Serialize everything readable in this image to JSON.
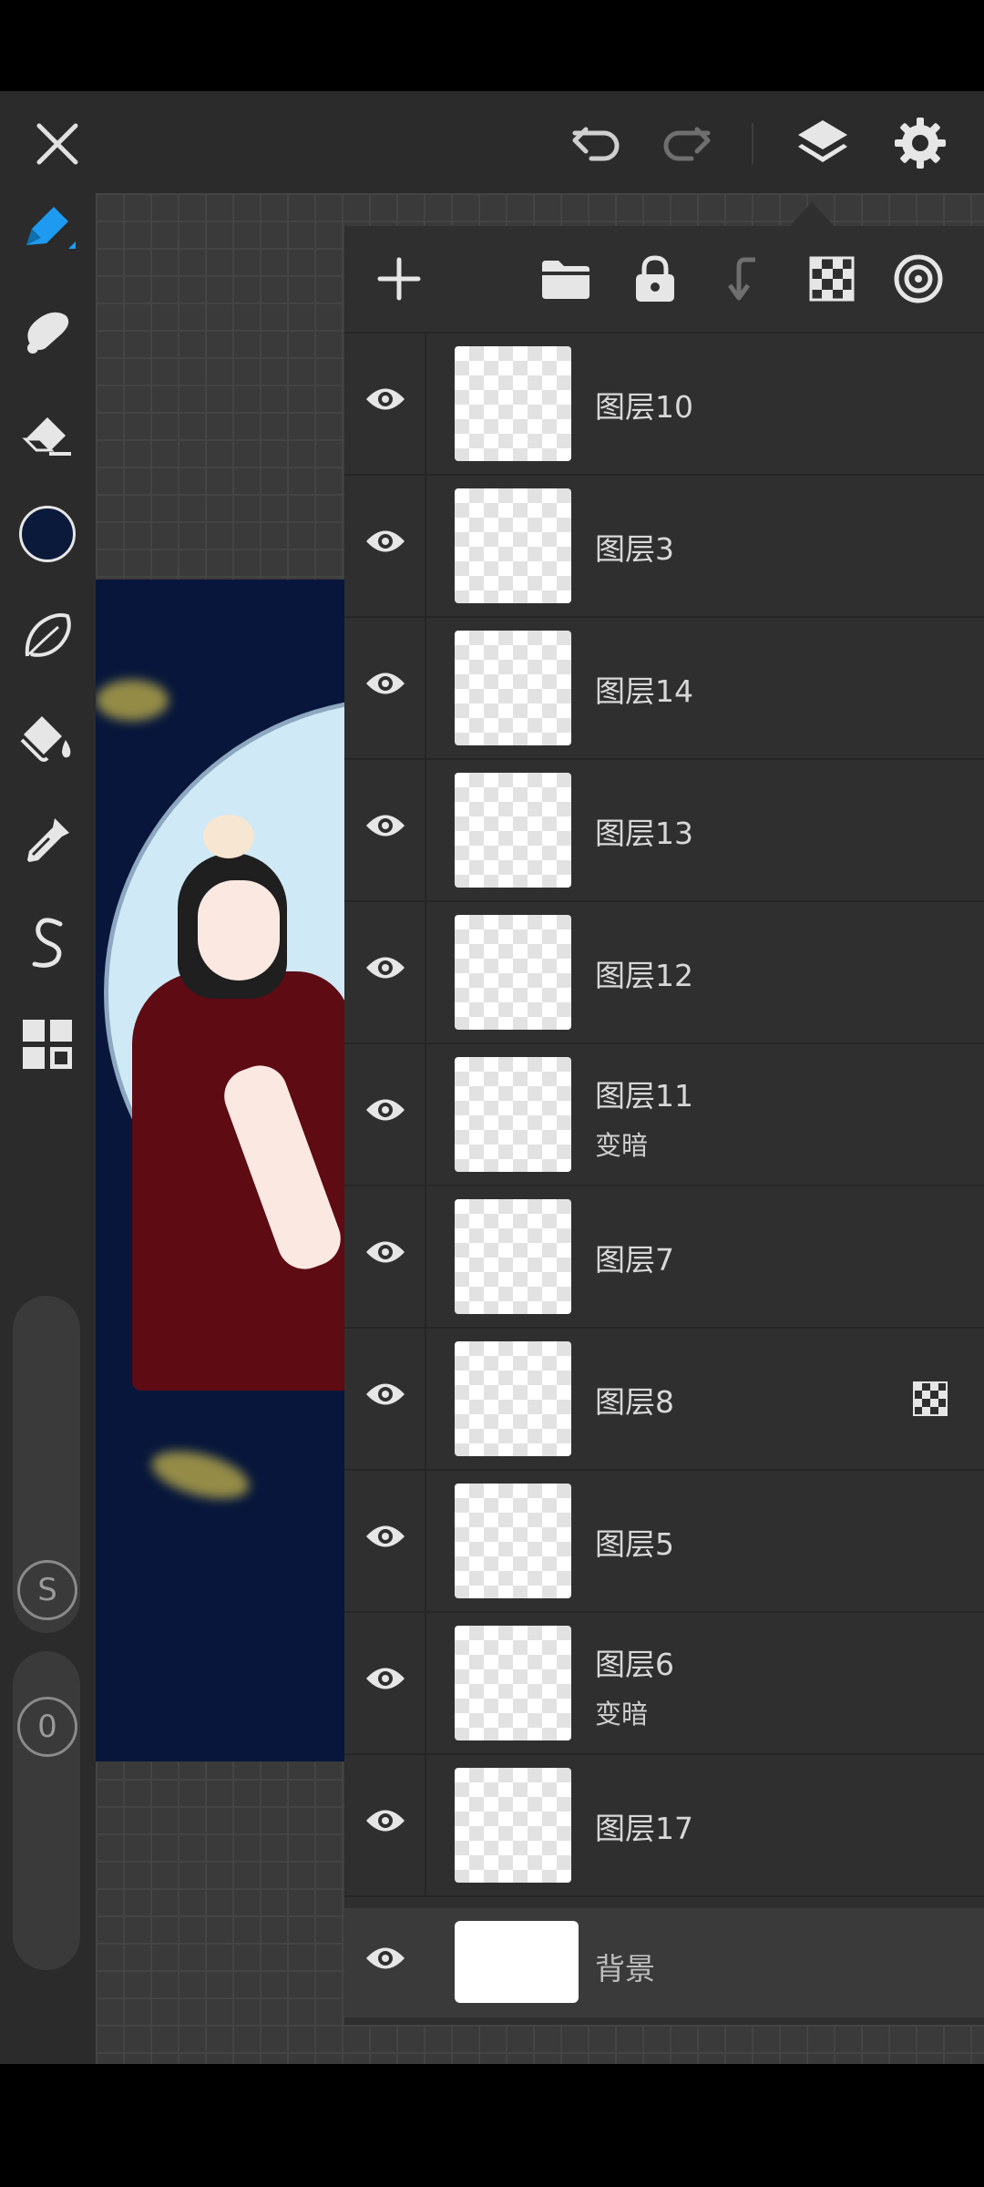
{
  "top_bar": {
    "close_icon": "close-icon",
    "undo_icon": "undo-icon",
    "redo_icon": "redo-icon",
    "layers_icon": "layers-icon",
    "settings_icon": "gear-icon"
  },
  "tools": [
    {
      "name": "pen-tool",
      "icon": "pen-icon",
      "active": true
    },
    {
      "name": "smudge-tool",
      "icon": "smudge-icon"
    },
    {
      "name": "eraser-tool",
      "icon": "eraser-icon"
    },
    {
      "name": "color-picker",
      "icon": "color-swatch",
      "color": "#0b1a3a"
    },
    {
      "name": "lasso-tool",
      "icon": "lasso-icon"
    },
    {
      "name": "fill-tool",
      "icon": "bucket-icon"
    },
    {
      "name": "eyedropper-tool",
      "icon": "eyedropper-icon"
    },
    {
      "name": "curve-tool",
      "icon": "curve-icon"
    },
    {
      "name": "more-tools",
      "icon": "grid-icon"
    }
  ],
  "size_slider_label": "S",
  "opacity_slider_label": "0",
  "layers_toolbar": {
    "add_icon": "plus-icon",
    "folder_icon": "folder-icon",
    "lock_icon": "lock-icon",
    "merge_down_icon": "merge-down-icon",
    "transparency_icon": "checker-icon",
    "blend_icon": "blend-icon"
  },
  "layers": [
    {
      "name": "图层10",
      "mode": "",
      "clip": false
    },
    {
      "name": "图层3",
      "mode": "",
      "clip": false
    },
    {
      "name": "图层14",
      "mode": "",
      "clip": false
    },
    {
      "name": "图层13",
      "mode": "",
      "clip": false
    },
    {
      "name": "图层12",
      "mode": "",
      "clip": false
    },
    {
      "name": "图层11",
      "mode": "变暗",
      "clip": false
    },
    {
      "name": "图层7",
      "mode": "",
      "clip": false
    },
    {
      "name": "图层8",
      "mode": "",
      "clip": true
    },
    {
      "name": "图层5",
      "mode": "",
      "clip": false
    },
    {
      "name": "图层6",
      "mode": "变暗",
      "clip": false
    },
    {
      "name": "图层17",
      "mode": "",
      "clip": false
    }
  ],
  "background_layer": {
    "name": "背景"
  },
  "colors": {
    "accent": "#1e9bf0",
    "panel": "#2f2f2f",
    "artwork_bg": "#07163a"
  }
}
